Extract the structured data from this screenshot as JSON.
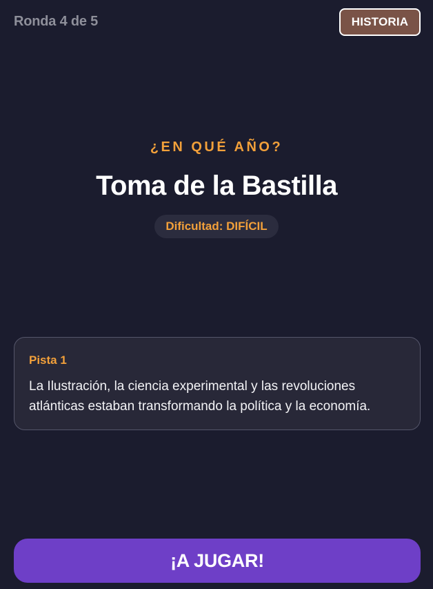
{
  "header": {
    "round_label": "Ronda 4 de 5",
    "category": "HISTORIA"
  },
  "question": {
    "prompt": "¿EN QUÉ AÑO?",
    "event": "Toma de la Bastilla",
    "difficulty": "Dificultad: DIFÍCIL"
  },
  "hint": {
    "title": "Pista 1",
    "text": "La Ilustración, la ciencia experimental y las revoluciones atlánticas estaban transformando la política y la economía."
  },
  "actions": {
    "play_label": "¡A JUGAR!"
  },
  "colors": {
    "background": "#1b1c2e",
    "accent": "#f2a03a",
    "category_badge": "#7a5347",
    "play_button": "#6e3fc7",
    "card": "#282838"
  }
}
